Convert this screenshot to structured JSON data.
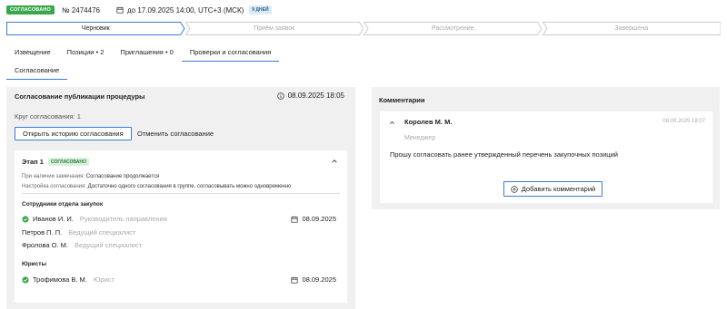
{
  "header": {
    "status_badge": "СОГЛАСОВАНО",
    "procedure_number": "№ 2474476",
    "deadline": "до 17.09.2025 14:00, UTC+3 (МСК)",
    "days_badge": "9 ДНЕЙ",
    "status_color": "#3aa84a"
  },
  "stepper": [
    {
      "label": "Черновик",
      "active": true
    },
    {
      "label": "Приём заявок",
      "active": false
    },
    {
      "label": "Рассмотрение",
      "active": false
    },
    {
      "label": "Завершена",
      "active": false
    }
  ],
  "tabs": [
    {
      "label": "Извещение"
    },
    {
      "label": "Позиции • 2"
    },
    {
      "label": "Приглашения • 0"
    },
    {
      "label": "Проверки и согласования",
      "active": true
    }
  ],
  "subtabs": [
    {
      "label": "Согласование"
    }
  ],
  "approval": {
    "title": "Согласование публикации процедуры",
    "date": "08.09.2025 18:05",
    "round": "Круг согласования: 1",
    "history_button": "Открыть историю согласования",
    "cancel_button": "Отменить согласование",
    "stage": {
      "title": "Этап 1",
      "badge": "СОГЛАСОВАНО",
      "remark_key": "При наличии замечания:",
      "remark_value": "Согласование продолжается",
      "setting_key": "Настройка согласования:",
      "setting_value": "Достаточно одного согласования в группе, согласовывать можно одновременно",
      "group1_title": "Сотрудники отдела закупок",
      "group2_title": "Юристы",
      "people": [
        {
          "name": "Иванов И. И.",
          "role": "Руководитель направления",
          "date": "08.09.2025",
          "approved": true
        },
        {
          "name": "Петров П. П.",
          "role": "Ведущий специалист",
          "date": "",
          "approved": false
        },
        {
          "name": "Фролова О. М.",
          "role": "Ведущий специалист",
          "date": "",
          "approved": false
        },
        {
          "name": "Трофимова В. М.",
          "role": "Юрист",
          "date": "08.09.2025",
          "approved": true
        }
      ]
    }
  },
  "comments": {
    "title": "Комментарии",
    "author": "Королев М. М.",
    "time": "08.09.2025 18:07",
    "role": "Менеджер",
    "text": "Прошу согласовать ранее утвержденный перечень закупочных позиций",
    "add_button": "Добавить комментарий"
  },
  "accent_color": "#3a7bd5"
}
